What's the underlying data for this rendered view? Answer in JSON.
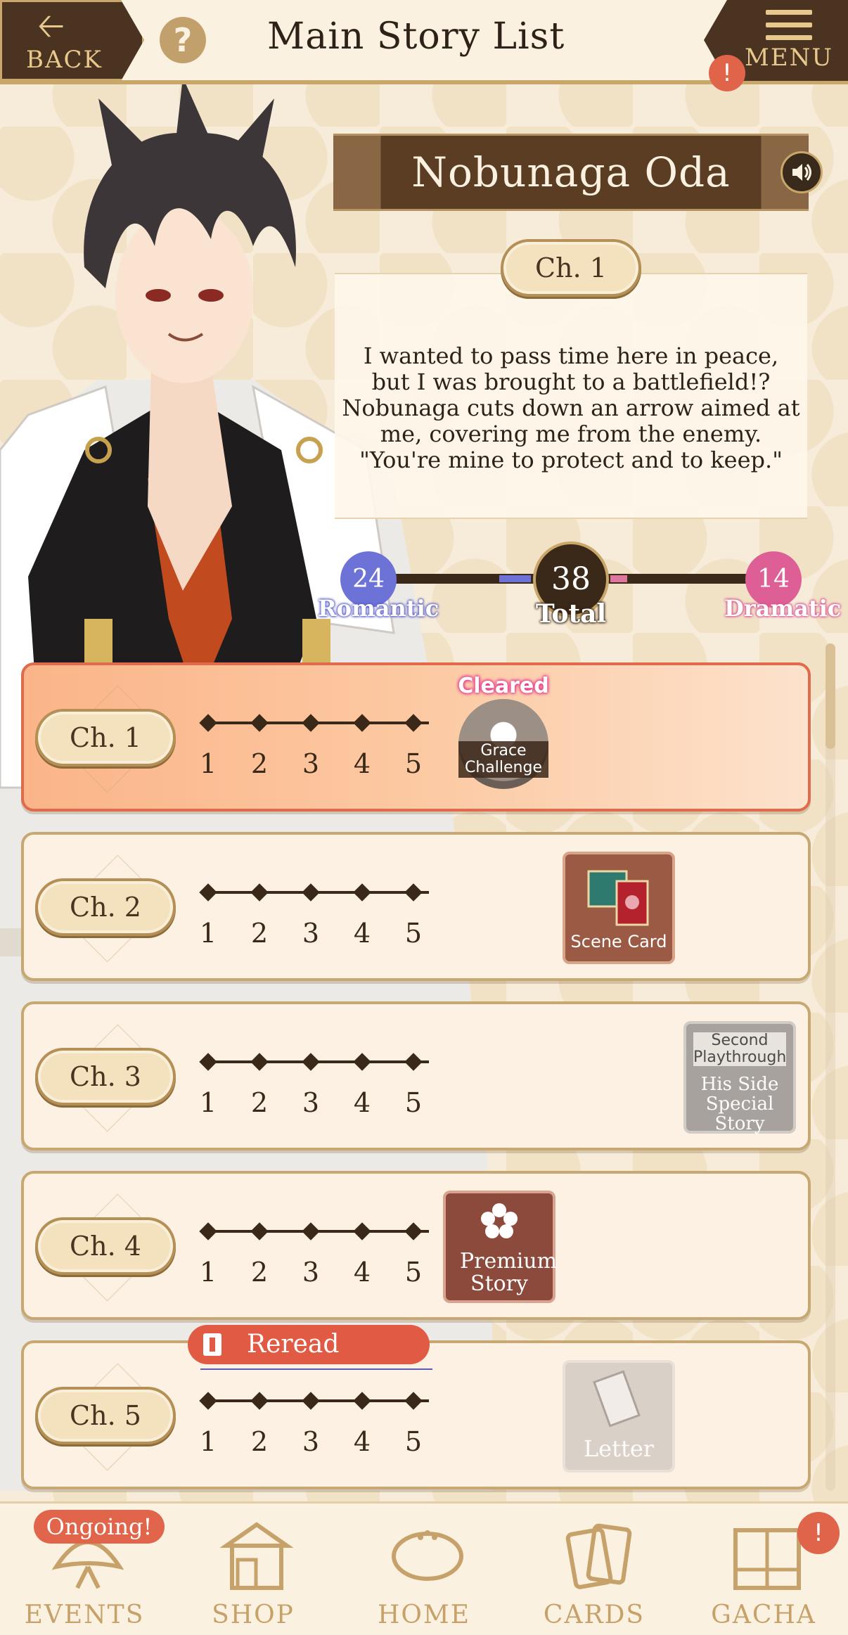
{
  "header": {
    "back_label": "BACK",
    "help_label": "?",
    "title": "Main Story List",
    "menu_label": "MENU",
    "menu_alert": "!"
  },
  "character": {
    "name": "Nobunaga Oda"
  },
  "selected_chapter": {
    "label": "Ch. 1",
    "description": "I wanted to pass time here in peace, but I was brought to a battlefield!? Nobunaga cuts down an arrow aimed at me, covering me from the enemy. \"You're mine to protect and to keep.\""
  },
  "stats": {
    "romantic_value": "24",
    "romantic_label": "Romantic",
    "total_value": "38",
    "total_label": "Total",
    "dramatic_value": "14",
    "dramatic_label": "Dramatic",
    "romantic_color": "#6d72d6",
    "dramatic_color": "#de77a0"
  },
  "step_numbers": [
    "1",
    "2",
    "3",
    "4",
    "5"
  ],
  "chapters": [
    {
      "label": "Ch. 1",
      "status": "active",
      "badge_top": "Cleared",
      "badge_caption": "Grace\nChallenge"
    },
    {
      "label": "Ch. 2",
      "badge_caption": "Scene Card"
    },
    {
      "label": "Ch. 3",
      "badge_top": "Second Playthrough",
      "badge_caption": "His Side Special Story"
    },
    {
      "label": "Ch. 4",
      "badge_caption": "Premium Story"
    },
    {
      "label": "Ch. 5",
      "badge_caption": "Letter",
      "reread_label": "Reread"
    }
  ],
  "bottom_nav": {
    "ongoing_label": "Ongoing!",
    "gacha_alert": "!",
    "items": [
      {
        "label": "EVENTS",
        "icon": "fan-icon"
      },
      {
        "label": "SHOP",
        "icon": "shop-icon"
      },
      {
        "label": "HOME",
        "icon": "home-icon"
      },
      {
        "label": "CARDS",
        "icon": "cards-icon"
      },
      {
        "label": "GACHA",
        "icon": "gacha-icon"
      }
    ]
  }
}
